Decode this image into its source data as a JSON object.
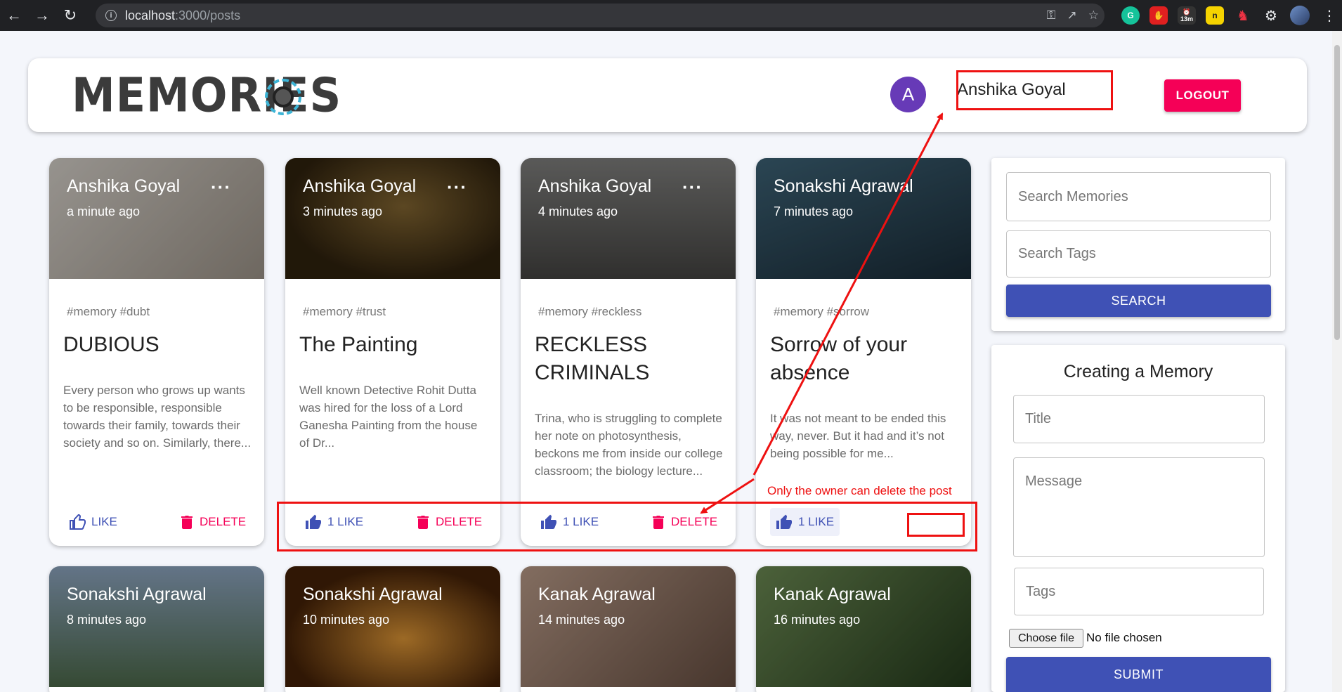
{
  "browser": {
    "url_host": "localhost",
    "url_path": ":3000/posts",
    "extension_badge": "13m"
  },
  "header": {
    "logo_text": "MEMORIES",
    "avatar_initial": "A",
    "username": "Anshika Goyal",
    "logout_label": "LOGOUT"
  },
  "posts": [
    {
      "author": "Anshika Goyal",
      "time": "a minute ago",
      "tags": "#memory #dubt",
      "title": "DUBIOUS",
      "message": "Every person who grows up wants to be responsible, responsible towards their family, towards their society and so on. Similarly, there...",
      "like_label": "LIKE",
      "delete_label": "DELETE",
      "bg": "#b9b4ad"
    },
    {
      "author": "Anshika Goyal",
      "time": "3 minutes ago",
      "tags": "#memory #trust",
      "title": "The Painting",
      "message": "Well known Detective Rohit Dutta was hired for the loss of a Lord Ganesha Painting from the house of Dr...",
      "like_label": "1 LIKE",
      "delete_label": "DELETE",
      "bg": "#6f5a2d"
    },
    {
      "author": "Anshika Goyal",
      "time": "4 minutes ago",
      "tags": "#memory #reckless",
      "title": "RECKLESS CRIMINALS",
      "message": "Trina, who is struggling to complete her note on photosynthesis, beckons me from inside our college classroom; the biology lecture...",
      "like_label": "1 LIKE",
      "delete_label": "DELETE",
      "bg": "#5b5a58"
    },
    {
      "author": "Sonakshi Agrawal",
      "time": "7 minutes ago",
      "tags": "#memory #sorrow",
      "title": "Sorrow of your absence",
      "message": "It was not meant to be ended this way, never. But it had and it’s not being possible for me...",
      "like_label": "1 LIKE",
      "bg": "#2f4a5c"
    },
    {
      "author": "Sonakshi Agrawal",
      "time": "8 minutes ago",
      "bg": "#5e7a8e"
    },
    {
      "author": "Sonakshi Agrawal",
      "time": "10 minutes ago",
      "bg": "#7a4a1e"
    },
    {
      "author": "Kanak Agrawal",
      "time": "14 minutes ago",
      "bg": "#9a7d6c"
    },
    {
      "author": "Kanak Agrawal",
      "time": "16 minutes ago",
      "bg": "#4d6a3c"
    }
  ],
  "search": {
    "memories_placeholder": "Search Memories",
    "tags_placeholder": "Search Tags",
    "button_label": "SEARCH"
  },
  "form": {
    "heading": "Creating a Memory",
    "title_placeholder": "Title",
    "message_placeholder": "Message",
    "tags_placeholder": "Tags",
    "file_button": "Choose file",
    "file_status": "No file chosen",
    "submit_label": "SUBMIT"
  },
  "annotation": {
    "note": "Only the owner can delete the post",
    "color": "#ee1111"
  },
  "colors": {
    "primary": "#3f51b5",
    "secondary": "#f50057",
    "avatar": "#673ab7"
  }
}
